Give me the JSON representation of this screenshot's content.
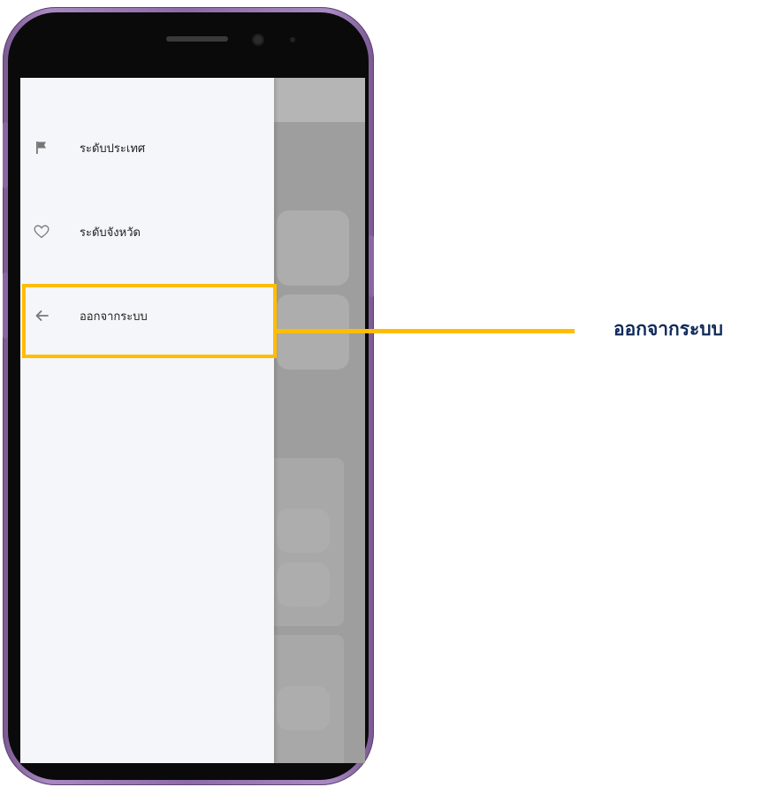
{
  "drawer": {
    "items": [
      {
        "label": "ระดับประเทศ",
        "icon": "flag-icon"
      },
      {
        "label": "ระดับจังหวัด",
        "icon": "heart-icon"
      },
      {
        "label": "ออกจากระบบ",
        "icon": "arrow-left-icon"
      }
    ]
  },
  "annotation": {
    "callout": "ออกจากระบบ",
    "color": "#ffbd00",
    "text_color": "#112a5a"
  },
  "device": {
    "frame_color": "#8d6aa8"
  }
}
